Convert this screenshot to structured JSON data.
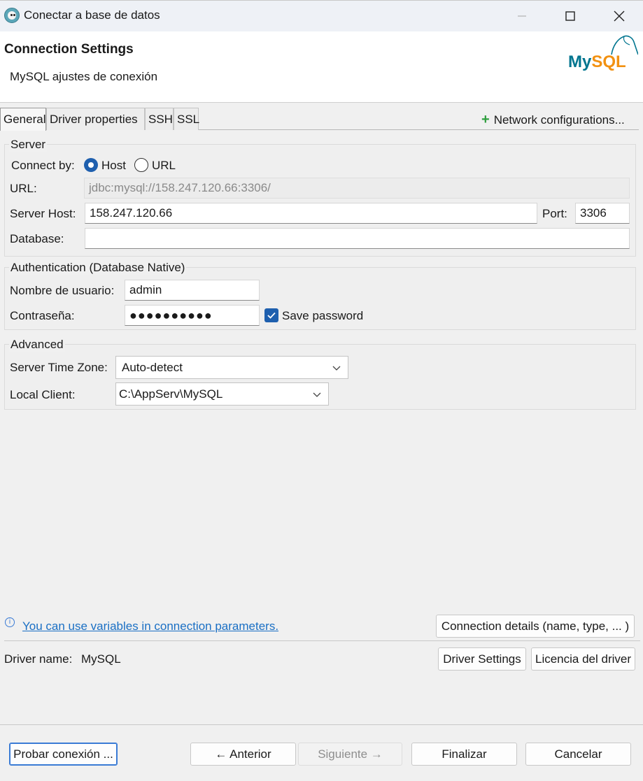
{
  "window": {
    "title": "Conectar a base de datos"
  },
  "header": {
    "title": "Connection Settings",
    "subtitle": "MySQL ajustes de conexión",
    "logo_text": "MySQL"
  },
  "tabs": [
    {
      "label": "General",
      "active": true
    },
    {
      "label": "Driver properties",
      "active": false
    },
    {
      "label": "SSH",
      "active": false
    },
    {
      "label": "SSL",
      "active": false
    }
  ],
  "network_config_label": "Network configurations...",
  "server": {
    "group_label": "Server",
    "connect_by_label": "Connect by:",
    "options": [
      "Host",
      "URL"
    ],
    "selected": "Host",
    "url_label": "URL:",
    "url_value": "jdbc:mysql://158.247.120.66:3306/",
    "host_label": "Server Host:",
    "host_value": "158.247.120.66",
    "port_label": "Port:",
    "port_value": "3306",
    "database_label": "Database:",
    "database_value": ""
  },
  "auth": {
    "group_label": "Authentication (Database Native)",
    "user_label": "Nombre de usuario:",
    "user_value": "admin",
    "password_label": "Contraseña:",
    "password_mask": "●●●●●●●●●●",
    "save_password_label": "Save password",
    "save_password_checked": true
  },
  "advanced": {
    "group_label": "Advanced",
    "timezone_label": "Server Time Zone:",
    "timezone_value": "Auto-detect",
    "client_label": "Local Client:",
    "client_value": "C:\\AppServ\\MySQL"
  },
  "footer": {
    "variables_link": "You can use variables in connection parameters.",
    "connection_details_button": "Connection details (name, type, ... )",
    "driver_name_label": "Driver name:",
    "driver_name_value": "MySQL",
    "driver_settings_button": "Driver Settings",
    "driver_license_button": "Licencia del driver"
  },
  "buttons": {
    "test": "Probar conexión ...",
    "back": "← Anterior",
    "next": "Siguiente →",
    "finish": "Finalizar",
    "cancel": "Cancelar"
  },
  "colors": {
    "accent": "#1e5fae",
    "link": "#1a6fc4",
    "plus": "#2e9e3e",
    "mysql_blue": "#00758f",
    "mysql_orange": "#f29111"
  }
}
